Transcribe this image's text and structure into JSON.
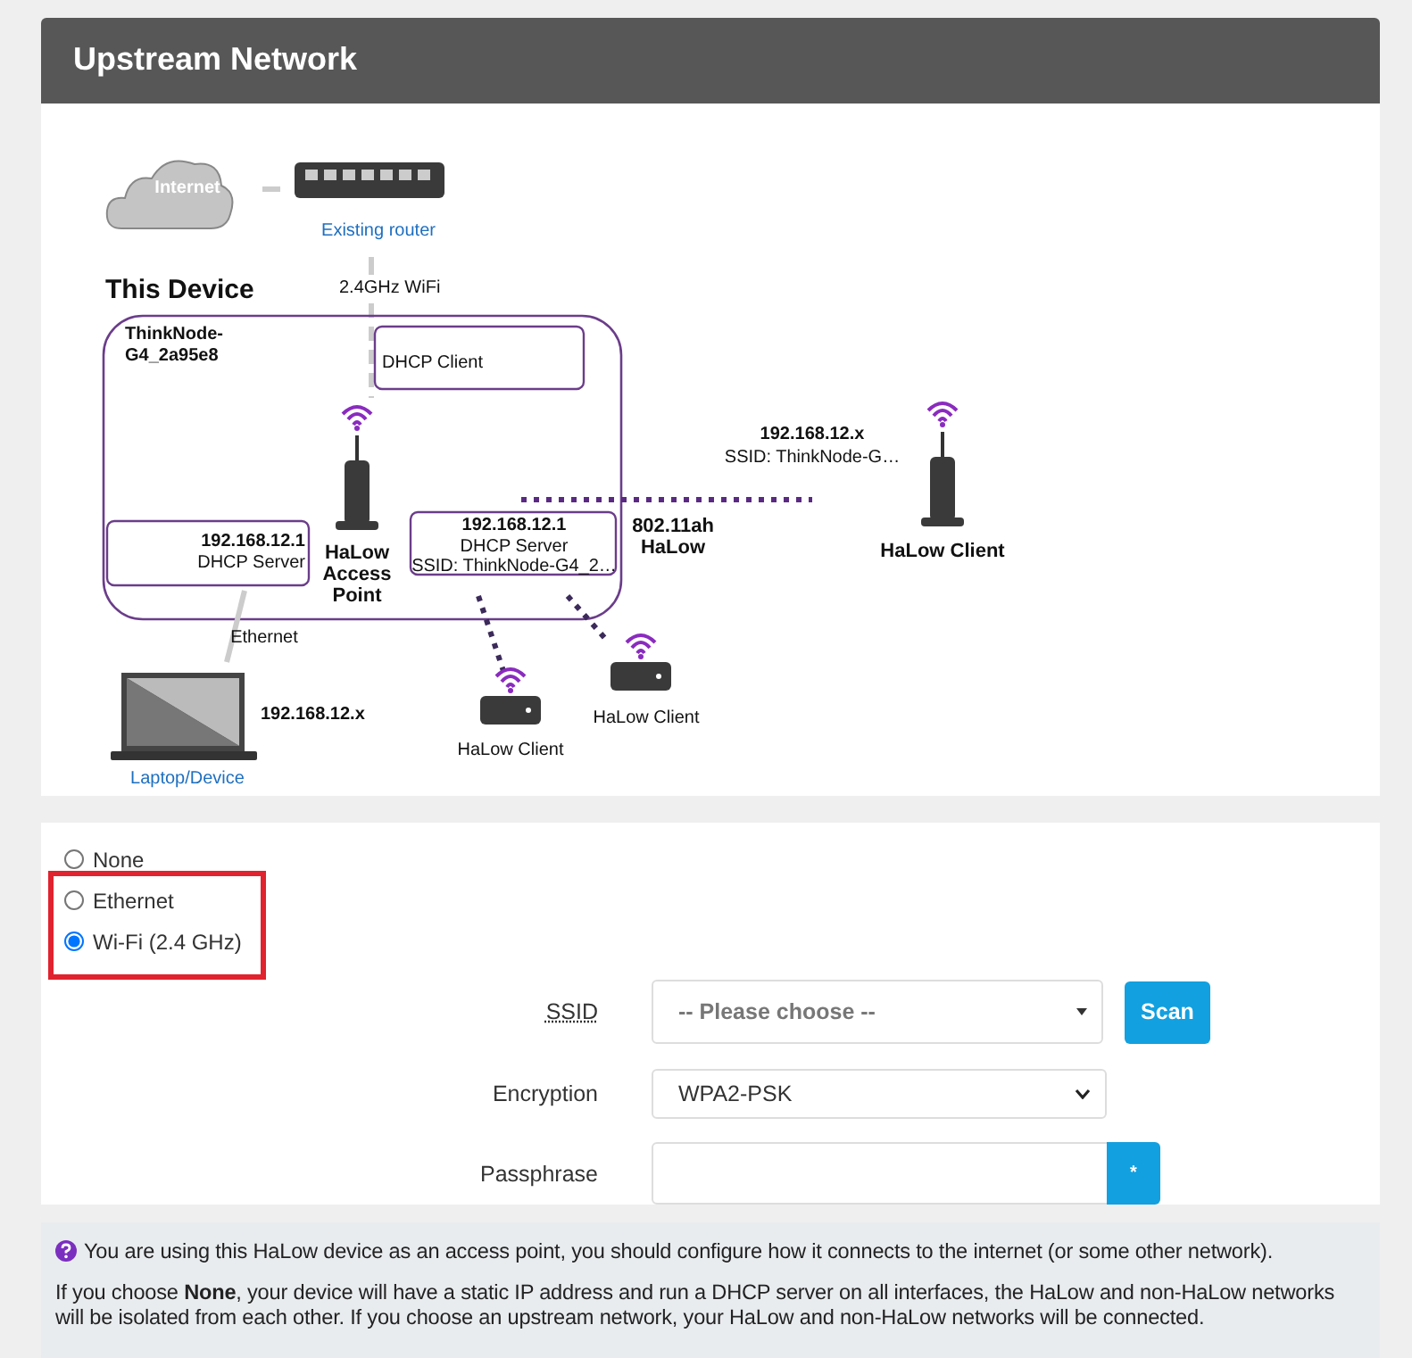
{
  "panel": {
    "title": "Upstream Network"
  },
  "diagram": {
    "labels": [
      {
        "kind": "cloud",
        "text": "Internet"
      },
      {
        "kind": "link",
        "text": "Existing router"
      },
      {
        "kind": "plain",
        "text": "2.4GHz WiFi"
      },
      {
        "kind": "heading",
        "text": "This Device"
      },
      {
        "kind": "bold",
        "text": "ThinkNode-G4_2a95e8"
      },
      {
        "kind": "plain",
        "text": "DHCP Client"
      },
      {
        "kind": "bold",
        "text": "192.168.12.1"
      },
      {
        "kind": "plain",
        "text": "DHCP Server"
      },
      {
        "kind": "big",
        "text": "HaLow Access Point"
      },
      {
        "kind": "bold",
        "text": "192.168.12.1"
      },
      {
        "kind": "plain",
        "text": "DHCP Server"
      },
      {
        "kind": "plain",
        "text": "SSID: ThinkNode-G4_2…"
      },
      {
        "kind": "big",
        "text": "802.11ah HaLow"
      },
      {
        "kind": "bold",
        "text": "192.168.12.x"
      },
      {
        "kind": "plain",
        "text": "SSID: ThinkNode-G…"
      },
      {
        "kind": "big",
        "text": "HaLow Client"
      },
      {
        "kind": "plain",
        "text": "HaLow Client"
      },
      {
        "kind": "plain",
        "text": "HaLow Client"
      },
      {
        "kind": "plain",
        "text": "Ethernet"
      },
      {
        "kind": "bold",
        "text": "192.168.12.x"
      },
      {
        "kind": "link",
        "text": "Laptop/Device"
      }
    ]
  },
  "options": [
    {
      "label": "None",
      "selected": false
    },
    {
      "label": "Ethernet",
      "selected": false
    },
    {
      "label": "Wi-Fi (2.4 GHz)",
      "selected": true
    }
  ],
  "fields": [
    {
      "kind": "dropdown",
      "label": "SSID",
      "placeholder": "-- Please choose --",
      "button": "Scan"
    },
    {
      "kind": "select",
      "label": "Encryption",
      "value": "WPA2-PSK"
    },
    {
      "kind": "password",
      "label": "Passphrase",
      "button": "*"
    }
  ],
  "info": [
    "You are using this HaLow device as an access point, you should configure how it connects to the internet (or some other network).",
    "If you choose **None**, your device will have a static IP address and run a DHCP server on all interfaces, the HaLow and non-HaLow networks will be isolated from each other. If you choose an upstream network, your HaLow and non-HaLow networks will be connected."
  ]
}
